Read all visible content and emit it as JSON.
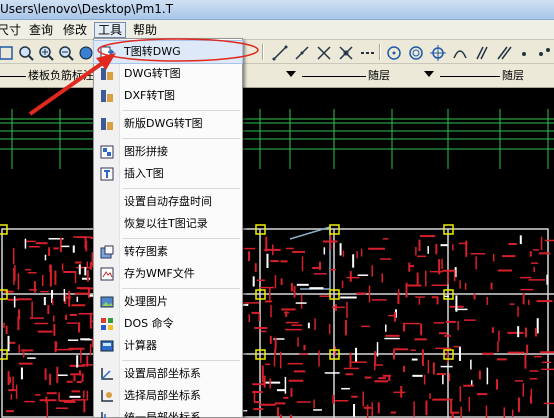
{
  "window": {
    "title": "Users\\lenovo\\Desktop\\Pm1.T"
  },
  "menubar": {
    "items": [
      {
        "label": "尺寸"
      },
      {
        "label": "查询"
      },
      {
        "label": "修改"
      },
      {
        "label": "工具"
      },
      {
        "label": "帮助"
      }
    ]
  },
  "layerbar": {
    "left_label": "楼板负筋标注",
    "layer_a": "随层",
    "layer_b": "随层"
  },
  "tools_menu": {
    "items": [
      {
        "label": "T图转DWG",
        "icon": "convert-to-dwg-icon"
      },
      {
        "label": "DWG转T图",
        "icon": "dwg-to-t-icon"
      },
      {
        "label": "DXF转T图",
        "icon": "dxf-to-t-icon"
      },
      {
        "label": "新版DWG转T图",
        "icon": "new-dwg-to-t-icon"
      },
      {
        "label": "图形拼接",
        "icon": "merge-graphics-icon"
      },
      {
        "label": "插入T图",
        "icon": "insert-t-icon"
      },
      {
        "label": "设置自动存盘时间",
        "icon": ""
      },
      {
        "label": "恢复以往T图记录",
        "icon": ""
      },
      {
        "label": "转存图素",
        "icon": "save-elements-icon"
      },
      {
        "label": "存为WMF文件",
        "icon": "save-wmf-icon"
      },
      {
        "label": "处理图片",
        "icon": "image-process-icon"
      },
      {
        "label": "DOS 命令",
        "icon": "dos-command-icon"
      },
      {
        "label": "计算器",
        "icon": "calculator-icon"
      },
      {
        "label": "设置局部坐标系",
        "icon": "set-local-coords-icon"
      },
      {
        "label": "选择局部坐标系",
        "icon": "select-local-coords-icon"
      },
      {
        "label": "统一局部坐标系",
        "icon": "unify-local-coords-icon"
      }
    ]
  },
  "colors": {
    "annotation": "#e0281f",
    "highlight": "#dde9f8",
    "canvas_bg": "#000000",
    "rebar_red": "#d8202a",
    "grid_green": "#2ec24a",
    "node_yellow": "#f0f000",
    "wall_white": "#ffffff"
  }
}
